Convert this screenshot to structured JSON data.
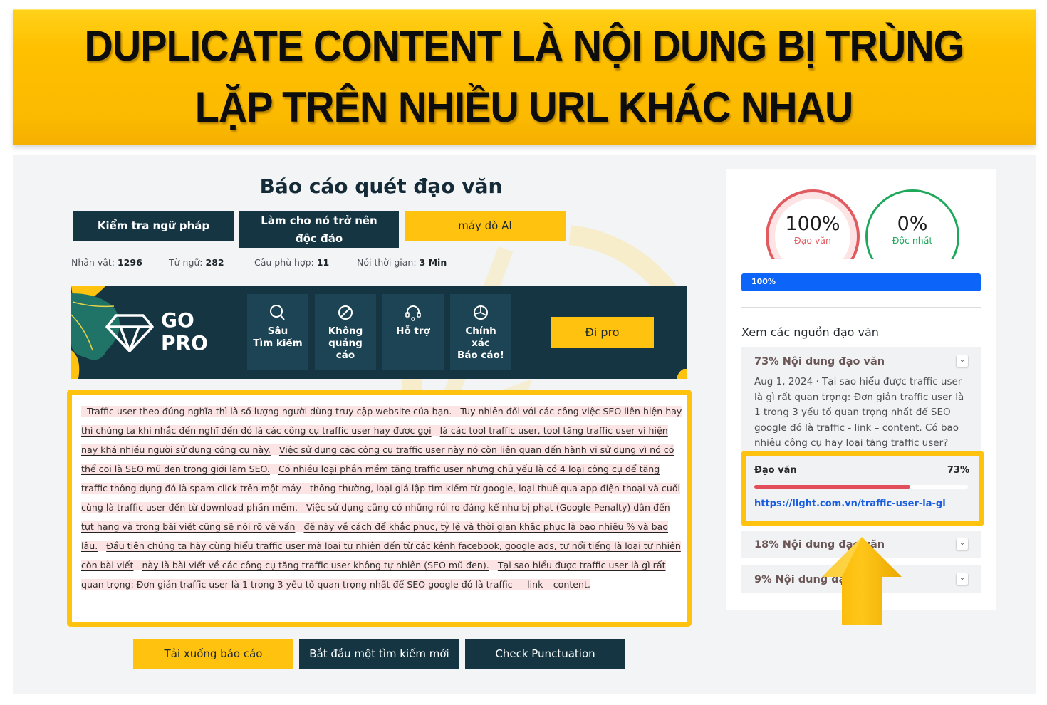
{
  "banner": {
    "line1": "DUPLICATE CONTENT LÀ NỘI DUNG BỊ TRÙNG",
    "line2": "LẶP TRÊN NHIỀU URL KHÁC NHAU"
  },
  "report": {
    "title": "Báo cáo quét đạo văn",
    "actions": [
      {
        "label": "Kiểm tra ngữ pháp"
      },
      {
        "label": "Làm cho nó trở nên độc đáo"
      },
      {
        "label": "máy dò AI"
      }
    ],
    "stats": [
      {
        "label": "Nhân vật:",
        "value": "1296"
      },
      {
        "label": "Từ ngữ:",
        "value": "282"
      },
      {
        "label": "Câu phù hợp:",
        "value": "11"
      },
      {
        "label": "Nói thời gian:",
        "value": "3 Min"
      }
    ]
  },
  "gopro": {
    "title_line1": "GO",
    "title_line2": "PRO",
    "features": [
      {
        "icon": "search-icon",
        "label": "Sâu\nTìm kiếm"
      },
      {
        "icon": "no-ads-icon",
        "label": "Không\nquảng\ncáo"
      },
      {
        "icon": "headset-icon",
        "label": "Hỗ trợ"
      },
      {
        "icon": "pie-chart-icon",
        "label": "Chính\nxác\nBáo cáo!"
      }
    ],
    "cta": "Đi pro"
  },
  "content": {
    "segments": [
      {
        "text": "Traffic user theo đúng nghĩa thì là số lượng người dùng truy cập website của bạn.",
        "matched": true
      },
      {
        "text": "Tuy nhiên đối với các công việc SEO liên hiện hay thì chúng ta khi nhắc đến nghĩ đến đó là các công cụ traffic user hay được gọi",
        "matched": true
      },
      {
        "text": "là các tool traffic user, tool tăng traffic user vì hiện nay khá nhiều người sử dụng công cụ này.",
        "matched": true
      },
      {
        "text": "Việc sử dụng các công cụ traffic user này nó còn liên quan đến hành vi sử dụng vì nó có thể coi là SEO mũ đen trong giới làm SEO.",
        "matched": true
      },
      {
        "text": "Có nhiều loại phần mềm tăng traffic user nhưng chủ yếu là có 4 loại công cụ để tăng traffic thông dụng đó là spam click trên một máy",
        "matched": true
      },
      {
        "text": "thông thường, loại giả lập tìm kiếm từ google, loại thuê qua app điện thoại và cuối cùng là traffic user đến từ download phần mềm.",
        "matched": true
      },
      {
        "text": "Việc sử dụng cũng có những rủi ro đáng kể như bị phạt (Google Penalty) dẫn đến tụt hạng và trong bài viết cũng sẽ nói rõ về vấn",
        "matched": true
      },
      {
        "text": "đề này về cách để khắc phục, tỷ lệ và thời gian khắc phục là bao nhiêu % và bao lâu.",
        "matched": true
      },
      {
        "text": "Đầu tiên chúng ta hãy cùng hiểu traffic user mà loại tự nhiên đến từ các kênh facebook, google ads, tự nổi tiếng là loại tự nhiên còn bài viết",
        "matched": true
      },
      {
        "text": "này là bài viết về các công cụ tăng traffic user không tự nhiên (SEO mũ đen).",
        "matched": true
      },
      {
        "text": "Tại sao hiểu được traffic user là gì rất quan trọng: Đơn giản traffic user là 1 trong 3 yếu tố quan trọng nhất để SEO google đó là traffic",
        "matched": true
      },
      {
        "text": "- link – content.",
        "matched": false
      }
    ]
  },
  "bottom_actions": [
    {
      "label": "Tải xuống báo cáo"
    },
    {
      "label": "Bắt đầu một tìm kiếm mới"
    },
    {
      "label": "Check Punctuation"
    }
  ],
  "side": {
    "plagiarism": {
      "value": "100%",
      "label": "Đạo văn",
      "percent": 100,
      "color": "#e15a60"
    },
    "unique": {
      "value": "0%",
      "label": "Độc nhất",
      "percent": 0,
      "color": "#1ea85a"
    },
    "progress": {
      "label": "100%",
      "percent": 100
    },
    "sources_title": "Xem các nguồn đạo văn",
    "sources": [
      {
        "heading": "73% Nội dung đạo văn",
        "description": "Aug 1, 2024 · Tại sao hiểu được traffic user là gì rất quan trọng: Đơn giản traffic user là 1 trong 3 yếu tố quan trọng nhất để SEO google đó là traffic - link – content. Có bao nhiêu công cụ hay loại tăng traffic user?",
        "match_label": "Đạo văn",
        "match_value": "73%",
        "match_percent": 73,
        "url": "https://light.com.vn/traffic-user-la-gi"
      },
      {
        "heading": "18% Nội dung đạo văn"
      },
      {
        "heading": "9% Nội dung đạo văn"
      }
    ]
  },
  "colors": {
    "dark": "#163543",
    "accent": "#ffc20e",
    "danger": "#e24f5a",
    "success": "#1ea85a",
    "link": "#1a5ee0",
    "progress": "#0d64f8"
  }
}
